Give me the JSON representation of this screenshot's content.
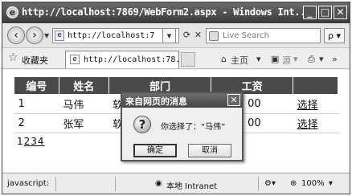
{
  "window": {
    "title": "http://localhost:7869/WebForm2.aspx - Windows Int...",
    "minimize": "_",
    "maximize": "□",
    "close": "✕"
  },
  "address_bar": {
    "url": "http://localhost:7",
    "dropdown": "▾",
    "refresh": "⟳",
    "stop": "✕",
    "search_placeholder": "Live Search",
    "search_go": "ρ ▾"
  },
  "favorites": {
    "label": "收藏夹",
    "tab_title": "http://localhost:78...",
    "home_label": "主页",
    "feeds_label": "源"
  },
  "grid": {
    "headers": [
      "编号",
      "姓名",
      "部门",
      "工资",
      ""
    ],
    "rows": [
      {
        "id": "1",
        "name": "马伟",
        "dept": "软",
        "salary": "00",
        "action": "选择"
      },
      {
        "id": "2",
        "name": "张军",
        "dept": "软",
        "salary": "00",
        "action": "选择"
      }
    ],
    "pager": [
      "1",
      "2",
      "3",
      "4"
    ]
  },
  "dialog": {
    "title": "来自网页的消息",
    "close": "✕",
    "icon_glyph": "?",
    "message": "你选择了：“马伟”",
    "ok_label": "确定",
    "cancel_label": "取消"
  },
  "status": {
    "left": "javascript:",
    "zone": "本地 Intranet",
    "zoom": "100%"
  }
}
